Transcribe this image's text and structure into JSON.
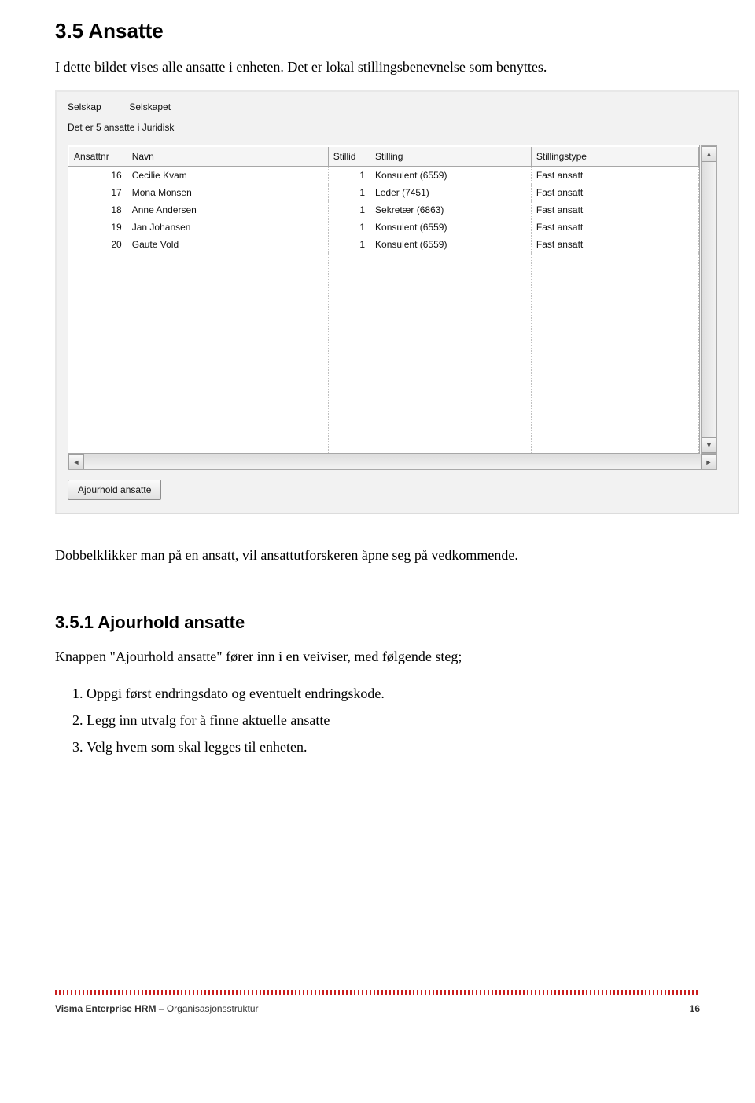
{
  "heading": "3.5 Ansatte",
  "intro": "I dette bildet vises alle ansatte i enheten. Det er lokal stillingsbenevnelse som benyttes.",
  "panel": {
    "selskap_label": "Selskap",
    "selskap_value": "Selskapet",
    "count_text": "Det er 5 ansatte i Juridisk",
    "columns": {
      "ansattnr": "Ansattnr",
      "navn": "Navn",
      "stillid": "Stillid",
      "stilling": "Stilling",
      "stillingstype": "Stillingstype"
    },
    "rows": [
      {
        "ansattnr": "16",
        "navn": "Cecilie Kvam",
        "stillid": "1",
        "stilling": "Konsulent (6559)",
        "stillingstype": "Fast ansatt"
      },
      {
        "ansattnr": "17",
        "navn": "Mona Monsen",
        "stillid": "1",
        "stilling": "Leder (7451)",
        "stillingstype": "Fast ansatt"
      },
      {
        "ansattnr": "18",
        "navn": "Anne Andersen",
        "stillid": "1",
        "stilling": "Sekretær (6863)",
        "stillingstype": "Fast ansatt"
      },
      {
        "ansattnr": "19",
        "navn": "Jan Johansen",
        "stillid": "1",
        "stilling": "Konsulent (6559)",
        "stillingstype": "Fast ansatt"
      },
      {
        "ansattnr": "20",
        "navn": "Gaute Vold",
        "stillid": "1",
        "stilling": "Konsulent (6559)",
        "stillingstype": "Fast ansatt"
      }
    ],
    "button_label": "Ajourhold ansatte"
  },
  "after_panel_text": "Dobbelklikker man på en ansatt, vil ansattutforskeren åpne seg på vedkommende.",
  "subheading": "3.5.1 Ajourhold ansatte",
  "subintro": "Knappen \"Ajourhold ansatte\" fører inn i en veiviser, med følgende steg;",
  "steps": [
    "Oppgi først endringsdato og eventuelt endringskode.",
    "Legg inn utvalg for å finne aktuelle ansatte",
    "Velg hvem som skal legges til enheten."
  ],
  "footer": {
    "left_bold": "Visma Enterprise HRM",
    "left_rest": " – Organisasjonsstruktur",
    "page_no": "16"
  }
}
